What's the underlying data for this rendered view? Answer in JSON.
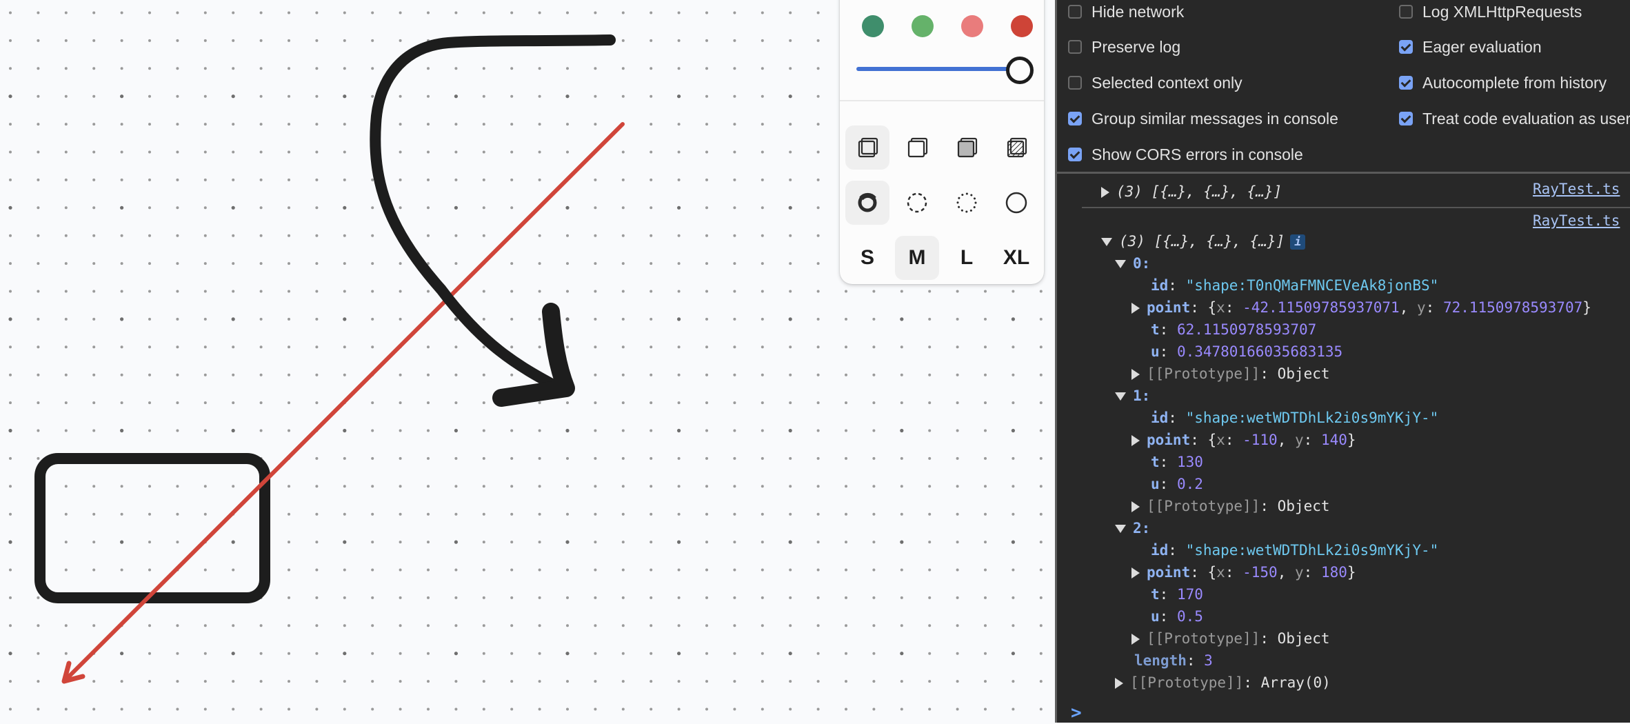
{
  "canvas": {
    "background": "#f9fafc",
    "grid_dot_color": "#9a9a9a",
    "grid_major_dot_color": "#6e6e6e",
    "shapes": [
      {
        "kind": "arrow",
        "name": "black-curved-arrow",
        "color": "#1d1d1d",
        "style": "draw",
        "size": "XL"
      },
      {
        "kind": "arrow",
        "name": "red-straight-arrow",
        "color": "#d0453a",
        "style": "solid",
        "size": "M"
      },
      {
        "kind": "rectangle",
        "name": "black-rectangle",
        "color": "#1d1d1d",
        "style": "draw",
        "size": "XL"
      }
    ]
  },
  "style_panel": {
    "colors": [
      {
        "name": "green",
        "hex": "#3f8e6c"
      },
      {
        "name": "light-green",
        "hex": "#65b26a"
      },
      {
        "name": "light-red",
        "hex": "#e97c7c"
      },
      {
        "name": "red",
        "hex": "#ce4437"
      }
    ],
    "opacity": {
      "value": 1.0,
      "track_color": "#4272d3"
    },
    "fill_options": [
      {
        "name": "fill-none",
        "active": true
      },
      {
        "name": "fill-semi",
        "active": false
      },
      {
        "name": "fill-solid",
        "active": false
      },
      {
        "name": "fill-pattern",
        "active": false
      }
    ],
    "dash_options": [
      {
        "name": "dash-draw",
        "active": true
      },
      {
        "name": "dash-dashed",
        "active": false
      },
      {
        "name": "dash-dotted",
        "active": false
      },
      {
        "name": "dash-solid",
        "active": false
      }
    ],
    "sizes": [
      {
        "label": "S",
        "active": false
      },
      {
        "label": "M",
        "active": true
      },
      {
        "label": "L",
        "active": false
      },
      {
        "label": "XL",
        "active": false
      }
    ]
  },
  "devtools": {
    "settings_left": [
      {
        "label": "Hide network",
        "checked": false
      },
      {
        "label": "Preserve log",
        "checked": false
      },
      {
        "label": "Selected context only",
        "checked": false
      },
      {
        "label": "Group similar messages in console",
        "checked": true
      },
      {
        "label": "Show CORS errors in console",
        "checked": true
      }
    ],
    "settings_right": [
      {
        "label": "Log XMLHttpRequests",
        "checked": false
      },
      {
        "label": "Eager evaluation",
        "checked": true
      },
      {
        "label": "Autocomplete from history",
        "checked": true
      },
      {
        "label": "Treat code evaluation as user action",
        "checked": true
      }
    ],
    "console": {
      "messages": [
        {
          "summary": "(3) [{…}, {…}, {…}]",
          "source": "RayTest.ts",
          "expanded": false
        },
        {
          "summary": "(3) [{…}, {…}, {…}]",
          "source": "RayTest.ts",
          "expanded": true,
          "info_badge": "i"
        }
      ],
      "items": [
        {
          "index": "0:",
          "id": "\"shape:T0nQMaFMNCEVeAk8jonBS\"",
          "point_x": "-42.11509785937071",
          "point_y": "72.1150978593707",
          "t": "62.1150978593707",
          "u": "0.34780166035683135"
        },
        {
          "index": "1:",
          "id": "\"shape:wetWDTDhLk2i0s9mYKjY-\"",
          "point_x": "-110",
          "point_y": "140",
          "t": "130",
          "u": "0.2"
        },
        {
          "index": "2:",
          "id": "\"shape:wetWDTDhLk2i0s9mYKjY-\"",
          "point_x": "-150",
          "point_y": "180",
          "t": "170",
          "u": "0.5"
        }
      ],
      "labels": {
        "id": "id",
        "point": "point",
        "t": "t",
        "u": "u",
        "x": "x",
        "y": "y",
        "prototype": "[[Prototype]]",
        "object": "Object",
        "length_key": "length",
        "length_val": "3",
        "array_proto": "Array(0)",
        "prompt": ">"
      }
    }
  }
}
